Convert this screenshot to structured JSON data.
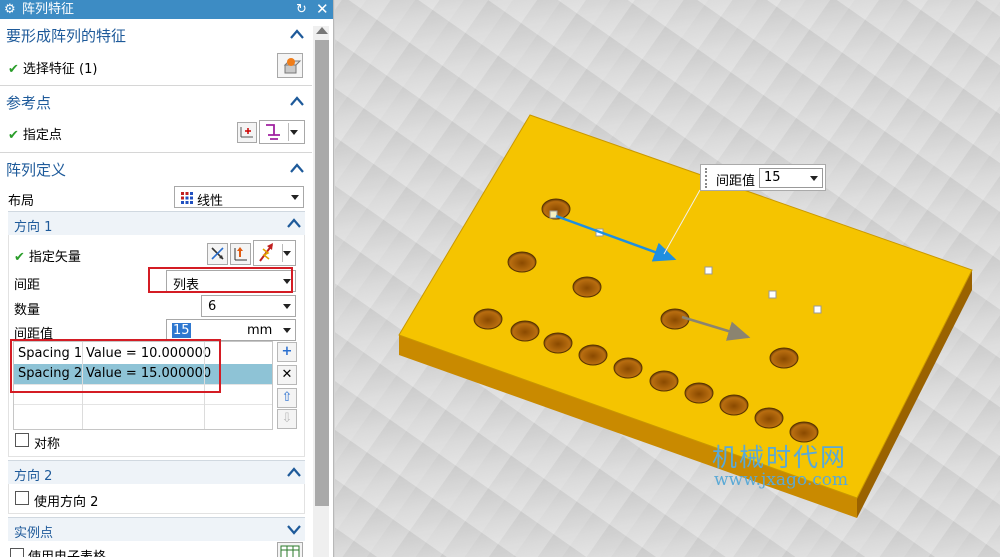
{
  "dialog": {
    "title": "阵列特征"
  },
  "sections": {
    "features": {
      "title": "要形成阵列的特征",
      "select_label": "选择特征 (1)"
    },
    "reference": {
      "title": "参考点",
      "point_label": "指定点"
    },
    "pattern": {
      "title": "阵列定义",
      "layout_label": "布局",
      "layout_value": "线性",
      "direction1": {
        "title": "方向 1",
        "vector_label": "指定矢量",
        "spacing_label": "间距",
        "spacing_value": "列表",
        "count_label": "数量",
        "count_value": "6",
        "pitch_label": "间距值",
        "pitch_value": "15",
        "pitch_unit": "mm",
        "list": [
          {
            "name": "Spacing 1",
            "value": "Value = 10.000000"
          },
          {
            "name": "Spacing 2",
            "value": "Value = 15.000000"
          }
        ],
        "symmetric_label": "对称"
      },
      "direction2": {
        "title": "方向 2",
        "use_label": "使用方向 2"
      },
      "instance": {
        "title": "实例点",
        "spreadsheet_label": "使用电子表格"
      }
    }
  },
  "viewport": {
    "popup_label": "间距值",
    "popup_value": "15",
    "watermark_cn": "机械时代网",
    "watermark_url": "www.jxago.com"
  },
  "colors": {
    "title_bar": "#3d8cc4",
    "section_title": "#1e5a9a",
    "plate": "#f5c400",
    "highlight": "#d41c24",
    "selected_row": "#8ec3d6"
  }
}
